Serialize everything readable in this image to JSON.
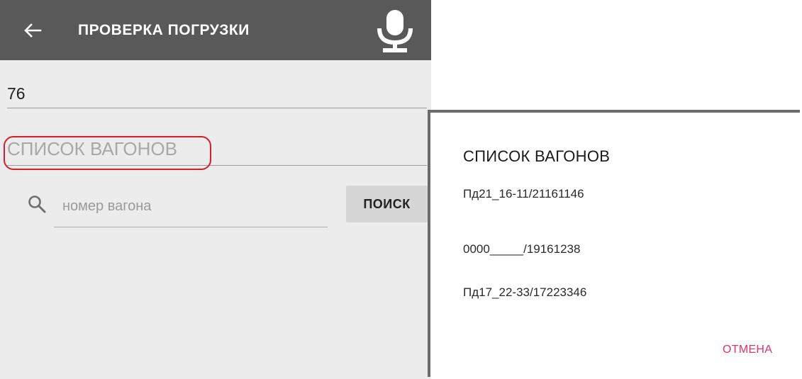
{
  "appbar": {
    "title": "ПРОВЕРКА ПОГРУЗКИ",
    "back_icon": "arrow-left-icon",
    "mic_icon": "microphone-icon",
    "background": "#595959"
  },
  "form": {
    "number_value": "76",
    "wagon_list_label": "СПИСОК ВАГОНОВ",
    "search": {
      "placeholder": "номер вагона",
      "icon": "search-icon",
      "button_label": "ПОИСК"
    }
  },
  "dialog": {
    "title": "СПИСОК ВАГОНОВ",
    "items": [
      "Пд21_16-11/21161146",
      "0000_____/19161238",
      "Пд17_22-33/17223346"
    ],
    "cancel_label": "ОТМЕНА",
    "accent": "#e0306e"
  },
  "annotation": {
    "highlight_color": "#d2202c"
  }
}
